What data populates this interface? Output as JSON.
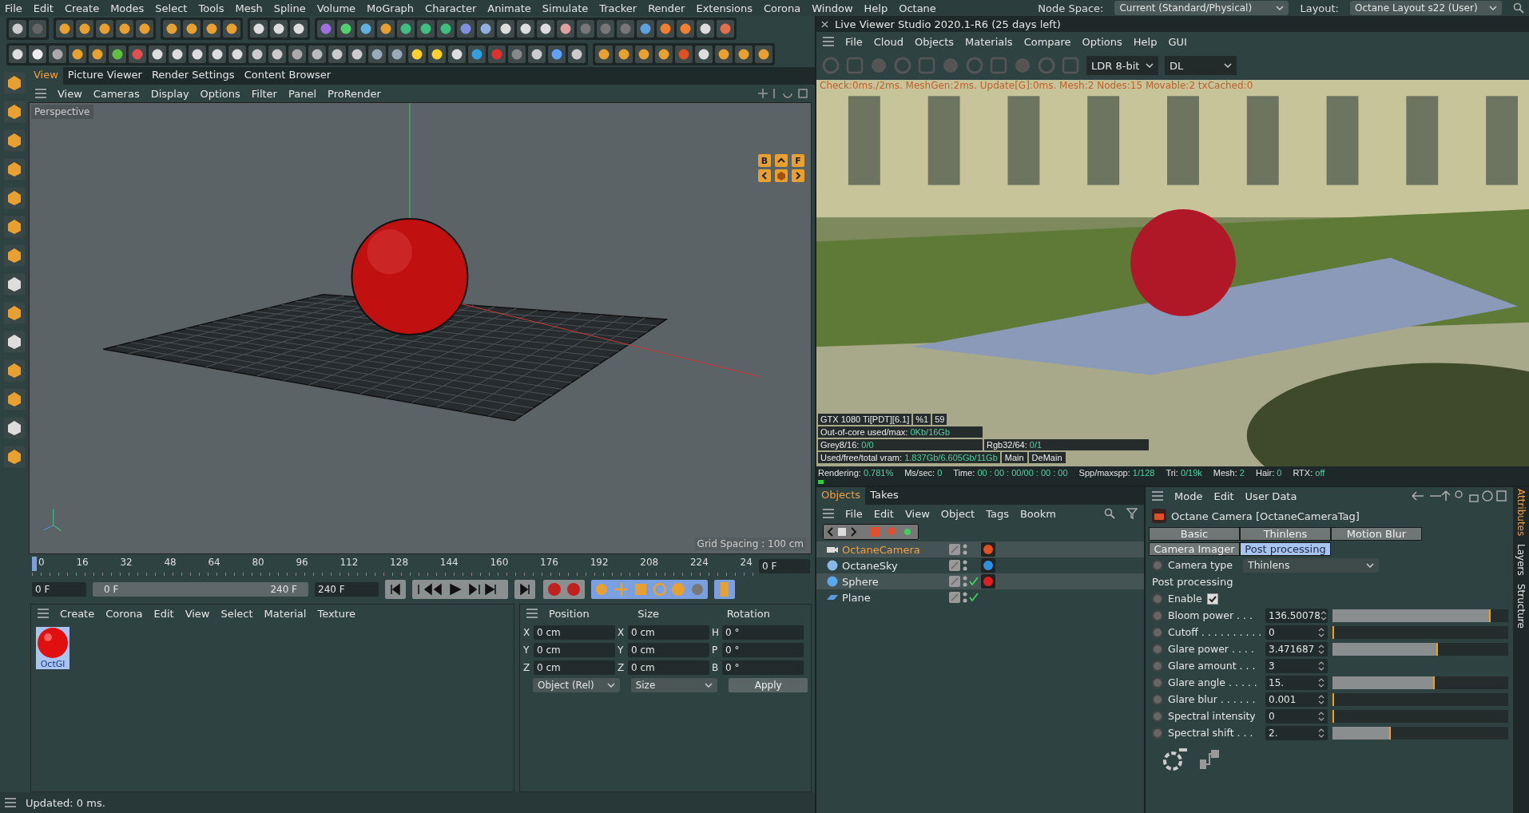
{
  "menu_bar": {
    "items": [
      "File",
      "Edit",
      "Create",
      "Modes",
      "Select",
      "Tools",
      "Mesh",
      "Spline",
      "Volume",
      "MoGraph",
      "Character",
      "Animate",
      "Simulate",
      "Tracker",
      "Render",
      "Extensions",
      "Corona",
      "Window",
      "Help",
      "Octane"
    ],
    "node_space": {
      "label": "Node Space:",
      "value": "Current (Standard/Physical)"
    },
    "layout": {
      "label": "Layout:",
      "value": "Octane Layout s22 (User)"
    }
  },
  "viewport_panel": {
    "tabs": [
      {
        "label": "View",
        "selected": true
      },
      {
        "label": "Picture Viewer",
        "selected": false
      },
      {
        "label": "Render Settings",
        "selected": false
      },
      {
        "label": "Content Browser",
        "selected": false
      }
    ],
    "menu": [
      "View",
      "Cameras",
      "Display",
      "Options",
      "Filter",
      "Panel",
      "ProRender"
    ],
    "view_label": "Perspective",
    "nav_letters": [
      "B",
      "F"
    ],
    "grid_spacing": "Grid Spacing : 100 cm"
  },
  "timeline": {
    "ticks": [
      "0",
      "16",
      "32",
      "48",
      "64",
      "80",
      "96",
      "112",
      "128",
      "144",
      "160",
      "176",
      "192",
      "208",
      "224",
      "24"
    ],
    "current_frame": "0 F",
    "start": "0 F",
    "range": {
      "start": "0 F",
      "end": "240 F",
      "level": 1
    },
    "end": "240 F"
  },
  "material_manager": {
    "menu": [
      "Create",
      "Corona",
      "Edit",
      "View",
      "Select",
      "Material",
      "Texture"
    ],
    "materials": [
      {
        "name": "OctGl",
        "selected": true
      }
    ]
  },
  "coordinates": {
    "headers": [
      "Position",
      "Size",
      "Rotation"
    ],
    "rows": [
      {
        "axes": [
          "X",
          "X",
          "H"
        ],
        "values": [
          "0 cm",
          "0 cm",
          "0 °"
        ]
      },
      {
        "axes": [
          "Y",
          "Y",
          "P"
        ],
        "values": [
          "0 cm",
          "0 cm",
          "0 °"
        ]
      },
      {
        "axes": [
          "Z",
          "Z",
          "B"
        ],
        "values": [
          "0 cm",
          "0 cm",
          "0 °"
        ]
      }
    ],
    "mode": "Object (Rel)",
    "size_mode": "Size",
    "apply": "Apply"
  },
  "status_bar": "Updated: 0 ms.",
  "live_viewer": {
    "title": "Live Viewer Studio 2020.1-R6 (25 days left)",
    "menu": [
      "File",
      "Cloud",
      "Objects",
      "Materials",
      "Compare",
      "Options",
      "Help",
      "GUI"
    ],
    "format": "LDR 8-bit",
    "kernel": "DL",
    "log": "Check:0ms./2ms. MeshGen:2ms. Update[G]:0ms. Mesh:2 Nodes:15 Movable:2 txCached:0",
    "device": [
      "GTX 1080 Ti[PDT][6.1]",
      "%1",
      "59"
    ],
    "stats": [
      [
        {
          "label": "Out-of-core used/max:",
          "value": "0Kb/16Gb"
        }
      ],
      [
        {
          "label": "Grey8/16:",
          "value": "0/0"
        },
        {
          "label": "Rgb32/64:",
          "value": "0/1"
        }
      ],
      [
        {
          "label": "Used/free/total vram:",
          "value": "1.837Gb/6.605Gb/11Gb"
        }
      ]
    ],
    "buttons": [
      "Main",
      "DeMain"
    ],
    "status": [
      {
        "label": "Rendering:",
        "value": "0.781%"
      },
      {
        "label": "Ms/sec:",
        "value": "0"
      },
      {
        "label": "Time:",
        "value": "00 : 00 : 00/00 : 00 : 00"
      },
      {
        "label": "Spp/maxspp:",
        "value": "1/128"
      },
      {
        "label": "Tri:",
        "value": "0/19k"
      },
      {
        "label": "Mesh:",
        "value": "2"
      },
      {
        "label": "Hair:",
        "value": "0"
      },
      {
        "label": "RTX:",
        "value": "off"
      }
    ],
    "progress": {
      "level": 0.008
    }
  },
  "objects_panel": {
    "tabs": [
      {
        "label": "Objects",
        "selected": true
      },
      {
        "label": "Takes",
        "selected": false
      }
    ],
    "menu": [
      "File",
      "Edit",
      "View",
      "Object",
      "Tags",
      "Bookm"
    ],
    "objects": [
      {
        "name": "OctaneCamera",
        "kind": "camera",
        "selected": true,
        "highlighted": true,
        "render_check": false
      },
      {
        "name": "OctaneSky",
        "kind": "sky",
        "selected": false,
        "highlighted": false,
        "render_check": false
      },
      {
        "name": "Sphere",
        "kind": "sphere",
        "selected": false,
        "highlighted": true,
        "render_check": true
      },
      {
        "name": "Plane",
        "kind": "plane",
        "selected": false,
        "highlighted": false,
        "render_check": true
      }
    ]
  },
  "attributes": {
    "menu": [
      "Mode",
      "Edit",
      "User Data"
    ],
    "title": "Octane Camera [OctaneCameraTag]",
    "tab_rows": [
      [
        {
          "label": "Basic",
          "selected": false
        },
        {
          "label": "Thinlens",
          "selected": false
        },
        {
          "label": "Motion Blur",
          "selected": false
        }
      ],
      [
        {
          "label": "Camera Imager",
          "selected": false
        },
        {
          "label": "Post processing",
          "selected": true
        }
      ]
    ],
    "camera_type": {
      "label": "Camera type",
      "value": "Thinlens"
    },
    "section": "Post processing",
    "enable": {
      "label": "Enable",
      "checked": true
    },
    "params": [
      {
        "label": "Bloom power . . .",
        "value": "136.50078",
        "kind": "slider",
        "level": 0.9
      },
      {
        "label": "Cutoff . . . . . . . . . .",
        "value": "0",
        "kind": "slider",
        "level": 0
      },
      {
        "label": "Glare power . . . .",
        "value": "3.471687",
        "kind": "slider",
        "level": 0.6
      },
      {
        "label": "Glare amount . . .",
        "value": "3",
        "kind": "number"
      },
      {
        "label": "Glare angle . . . . .",
        "value": "15.",
        "kind": "slider",
        "level": 0.58
      },
      {
        "label": "Glare blur . . . . . .",
        "value": "0.001",
        "kind": "slider",
        "level": 0
      },
      {
        "label": "Spectral intensity",
        "value": "0",
        "kind": "slider",
        "level": 0
      },
      {
        "label": "Spectral shift . . .",
        "value": "2.",
        "kind": "slider",
        "level": 0.33
      }
    ]
  },
  "side_tabs": [
    {
      "label": "Attributes",
      "selected": true
    },
    {
      "label": "Layers",
      "selected": false
    },
    {
      "label": "Structure",
      "selected": false
    }
  ]
}
